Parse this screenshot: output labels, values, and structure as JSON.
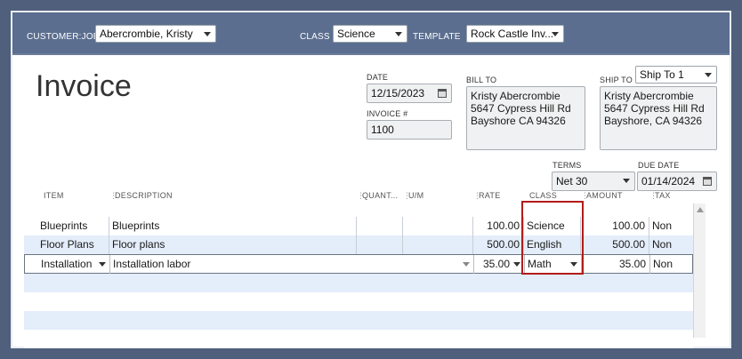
{
  "header": {
    "customer_job_label": "CUSTOMER:JOB",
    "customer_job_value": "Abercrombie, Kristy",
    "class_label": "CLASS",
    "class_value": "Science",
    "template_label": "TEMPLATE",
    "template_value": "Rock Castle Inv..."
  },
  "form": {
    "title": "Invoice",
    "date_label": "DATE",
    "date_value": "12/15/2023",
    "invoice_no_label": "INVOICE #",
    "invoice_no_value": "1100",
    "bill_to_label": "BILL TO",
    "bill_to_lines": [
      "Kristy Abercrombie",
      "5647 Cypress Hill Rd",
      "Bayshore CA 94326"
    ],
    "ship_to_label": "SHIP TO",
    "ship_to_select": "Ship To 1",
    "ship_to_lines": [
      "Kristy Abercrombie",
      "5647 Cypress Hill Rd",
      "Bayshore, CA 94326"
    ],
    "terms_label": "TERMS",
    "terms_value": "Net 30",
    "due_date_label": "DUE DATE",
    "due_date_value": "01/14/2024"
  },
  "table": {
    "columns": [
      "ITEM",
      "DESCRIPTION",
      "QUANT...",
      "U/M",
      "RATE",
      "CLASS",
      "AMOUNT",
      "TAX"
    ],
    "rows": [
      {
        "item": "Blueprints",
        "description": "Blueprints",
        "quantity": "",
        "um": "",
        "rate": "100.00",
        "class": "Science",
        "amount": "100.00",
        "tax": "Non"
      },
      {
        "item": "Floor Plans",
        "description": "Floor plans",
        "quantity": "",
        "um": "",
        "rate": "500.00",
        "class": "English",
        "amount": "500.00",
        "tax": "Non"
      },
      {
        "item": "Installation",
        "description": "Installation labor",
        "quantity": "",
        "um": "",
        "rate": "35.00",
        "class": "Math",
        "amount": "35.00",
        "tax": "Non"
      }
    ]
  },
  "colors": {
    "header_bar": "#5b6e8f",
    "frame": "#4f5f7c",
    "row_alt": "#e4edfa",
    "highlight": "#b31b1b"
  }
}
